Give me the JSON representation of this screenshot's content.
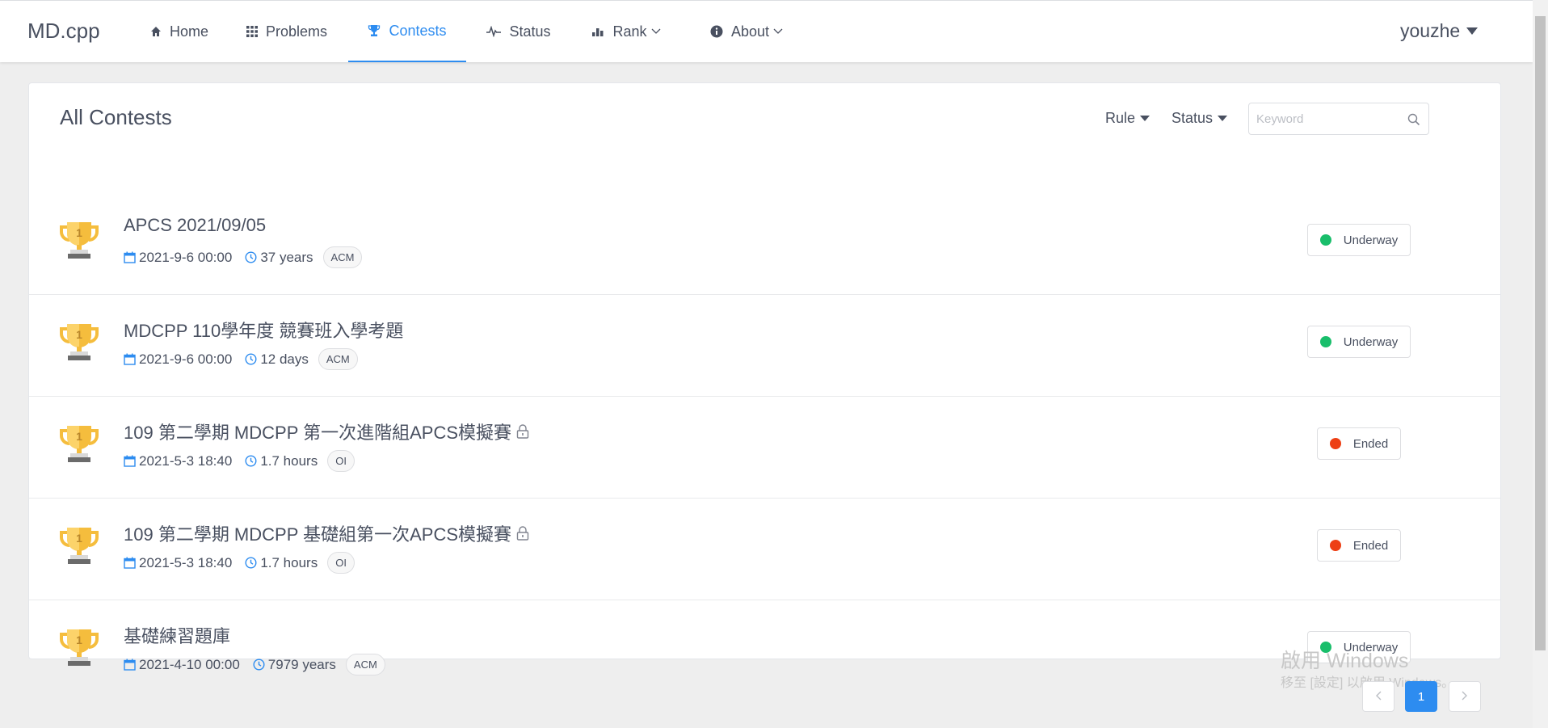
{
  "app": {
    "logo": "MD.cpp"
  },
  "nav": {
    "home": "Home",
    "problems": "Problems",
    "contests": "Contests",
    "status": "Status",
    "rank": "Rank",
    "about": "About"
  },
  "user": {
    "name": "youzhe"
  },
  "page": {
    "title": "All Contests",
    "filters": {
      "rule": "Rule",
      "status": "Status"
    },
    "search": {
      "placeholder": "Keyword",
      "value": ""
    }
  },
  "contests": [
    {
      "title": "APCS 2021/09/05",
      "start": "2021-9-6 00:00",
      "duration": "37 years",
      "rule": "ACM",
      "status": "Underway",
      "locked": false
    },
    {
      "title": "MDCPP 110學年度 競賽班入學考題",
      "start": "2021-9-6 00:00",
      "duration": "12 days",
      "rule": "ACM",
      "status": "Underway",
      "locked": false
    },
    {
      "title": "109 第二學期 MDCPP 第一次進階組APCS模擬賽",
      "start": "2021-5-3 18:40",
      "duration": "1.7 hours",
      "rule": "OI",
      "status": "Ended",
      "locked": true
    },
    {
      "title": "109 第二學期 MDCPP 基礎組第一次APCS模擬賽",
      "start": "2021-5-3 18:40",
      "duration": "1.7 hours",
      "rule": "OI",
      "status": "Ended",
      "locked": true
    },
    {
      "title": "基礎練習題庫",
      "start": "2021-4-10 00:00",
      "duration": "7979 years",
      "rule": "ACM",
      "status": "Underway",
      "locked": false
    }
  ],
  "status_colors": {
    "Underway": "#19be6b",
    "Ended": "#ed3f14"
  },
  "colors": {
    "accent": "#2d8cf0",
    "trophy_gold": "#f5bd3d",
    "trophy_base": "#6b6b6b"
  },
  "pagination": {
    "current": "1"
  },
  "watermark": {
    "line1": "啟用 Windows",
    "line2": "移至 [設定] 以啟用 Windows。"
  },
  "icons": {
    "nav": [
      "home-icon",
      "grid-icon",
      "trophy-icon",
      "pulse-icon",
      "bar-chart-icon",
      "info-icon"
    ],
    "row": [
      "trophy-icon",
      "calendar-icon",
      "clock-icon",
      "lock-icon"
    ],
    "search": "search-icon"
  }
}
